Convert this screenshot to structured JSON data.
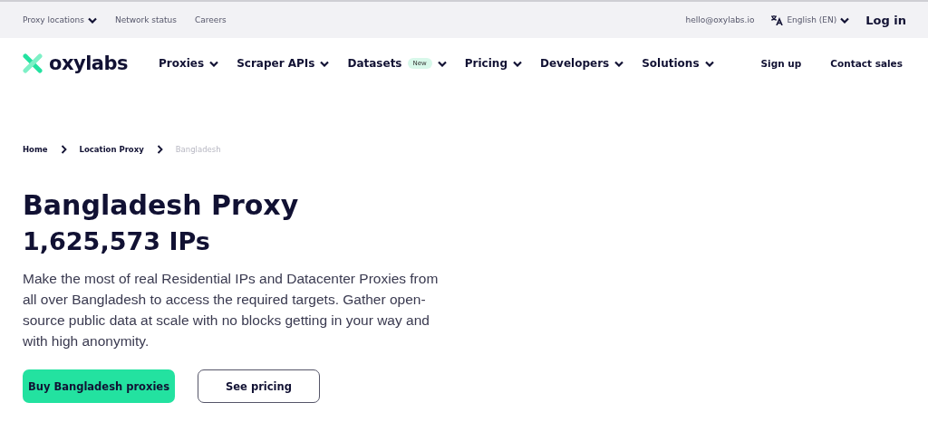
{
  "top_bar": {
    "links": [
      {
        "label": "Proxy locations",
        "dropdown": true
      },
      {
        "label": "Network status",
        "dropdown": false
      },
      {
        "label": "Careers",
        "dropdown": false
      }
    ],
    "email": "hello@oxylabs.io",
    "language": "English (EN)",
    "login": "Log in"
  },
  "nav": {
    "logo": "oxylabs",
    "items": [
      {
        "label": "Proxies"
      },
      {
        "label": "Scraper APIs"
      },
      {
        "label": "Datasets",
        "badge": "New"
      },
      {
        "label": "Pricing"
      },
      {
        "label": "Developers"
      },
      {
        "label": "Solutions"
      }
    ],
    "actions": [
      "Sign up",
      "Contact sales"
    ]
  },
  "breadcrumb": [
    {
      "label": "Home",
      "current": false
    },
    {
      "label": "Location Proxy",
      "current": false
    },
    {
      "label": "Bangladesh",
      "current": true
    }
  ],
  "hero": {
    "title": "Bangladesh Proxy",
    "subtitle": "1,625,573 IPs",
    "description": "Make the most of real Residential IPs and Datacenter Proxies from all over Bangladesh to access the required targets. Gather open-source public data at scale with no blocks getting in your way and with high anonymity.",
    "buttons": [
      {
        "label": "Buy Bangladesh proxies",
        "kind": "primary"
      },
      {
        "label": "See pricing",
        "kind": "outline"
      }
    ]
  }
}
